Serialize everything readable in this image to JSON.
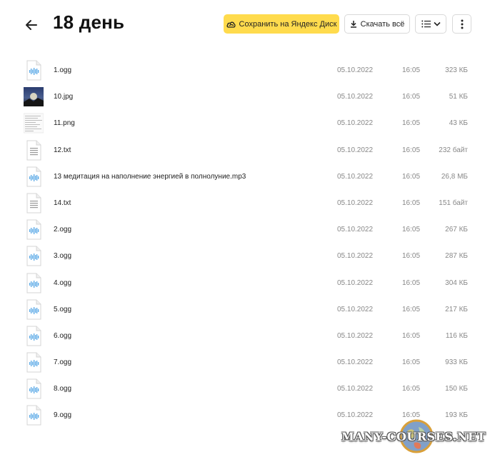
{
  "header": {
    "title": "18 день",
    "save_label": "Сохранить на Яндекс Диск",
    "download_label": "Скачать всё"
  },
  "files": [
    {
      "name": "1.ogg",
      "type": "audio",
      "date": "05.10.2022",
      "time": "16:05",
      "size": "323 КБ"
    },
    {
      "name": "10.jpg",
      "type": "image",
      "date": "05.10.2022",
      "time": "16:05",
      "size": "51 КБ"
    },
    {
      "name": "11.png",
      "type": "doc-image",
      "date": "05.10.2022",
      "time": "16:05",
      "size": "43 КБ"
    },
    {
      "name": "12.txt",
      "type": "text",
      "date": "05.10.2022",
      "time": "16:05",
      "size": "232 байт"
    },
    {
      "name": "13 медитация на наполнение энергией в полнолуние.mp3",
      "type": "audio",
      "date": "05.10.2022",
      "time": "16:05",
      "size": "26,8 МБ"
    },
    {
      "name": "14.txt",
      "type": "text",
      "date": "05.10.2022",
      "time": "16:05",
      "size": "151 байт"
    },
    {
      "name": "2.ogg",
      "type": "audio",
      "date": "05.10.2022",
      "time": "16:05",
      "size": "267 КБ"
    },
    {
      "name": "3.ogg",
      "type": "audio",
      "date": "05.10.2022",
      "time": "16:05",
      "size": "287 КБ"
    },
    {
      "name": "4.ogg",
      "type": "audio",
      "date": "05.10.2022",
      "time": "16:05",
      "size": "304 КБ"
    },
    {
      "name": "5.ogg",
      "type": "audio",
      "date": "05.10.2022",
      "time": "16:05",
      "size": "217 КБ"
    },
    {
      "name": "6.ogg",
      "type": "audio",
      "date": "05.10.2022",
      "time": "16:05",
      "size": "116 КБ"
    },
    {
      "name": "7.ogg",
      "type": "audio",
      "date": "05.10.2022",
      "time": "16:05",
      "size": "933 КБ"
    },
    {
      "name": "8.ogg",
      "type": "audio",
      "date": "05.10.2022",
      "time": "16:05",
      "size": "150 КБ"
    },
    {
      "name": "9.ogg",
      "type": "audio",
      "date": "05.10.2022",
      "time": "16:05",
      "size": "193 КБ"
    }
  ],
  "watermark": {
    "text": "MANY-COURSES.NET"
  },
  "icons": {
    "back": "arrow-left-icon",
    "save": "cloud-icon",
    "download": "download-icon",
    "view": "list-view-icon",
    "more": "more-vertical-icon"
  },
  "colors": {
    "accent": "#ffdb4d",
    "audio_wave": "#5aa9e6",
    "muted_text": "#888888"
  }
}
